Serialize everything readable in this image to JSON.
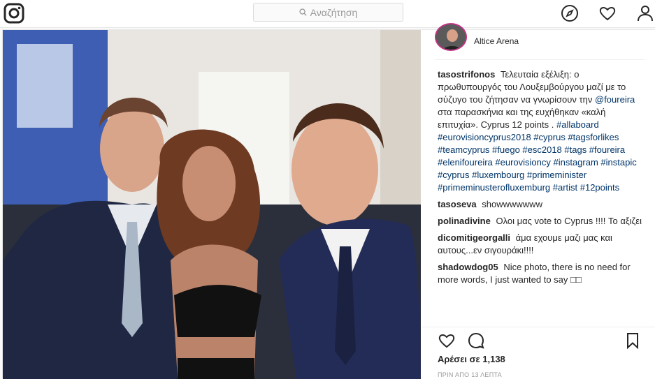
{
  "search": {
    "placeholder": "Αναζήτηση"
  },
  "post": {
    "location": "Altice Arena",
    "caption": {
      "user": "tasostrifonos",
      "text": "Τελευταία εξέλιξη: ο πρωθυπουργός του Λουξεμβούργου μαζί με το σύζυγο του ζήτησαν να γνωρίσουν την",
      "mention": "@foureira",
      "text2": "στα παρασκήνια και της ευχήθηκαν «καλή επιτυχία». Cyprus 12 points .",
      "hashtags": "#allaboard #eurovisioncyprus2018 #cyprus #tagsforlikes #teamcyprus #fuego #esc2018 #tags #foureira #elenifoureira #eurovisioncy #instagram #instapic #cyprus #luxembourg #primeminister #primeminusterofluxemburg #artist #12points"
    },
    "comments": [
      {
        "user": "tasoseva",
        "text": "showwwwwww"
      },
      {
        "user": "polinadivine",
        "text": "Ολοι μας vote to Cyprus !!!! Το αξιζει"
      },
      {
        "user": "dicomitigeorgalli",
        "text": "άμα εχουμε μαζι μας και αυτους...εν σιγουράκι!!!!"
      },
      {
        "user": "shadowdog05",
        "text": "Nice photo, there is no need for more words, I just wanted to say □□"
      }
    ],
    "likes": "Αρέσει σε 1,138",
    "timestamp": "ΠΡΙΝ ΑΠΟ 13 ΛΕΠΤΑ"
  },
  "icons": {
    "logo": "instagram-logo-icon",
    "explore": "compass-icon",
    "activity": "heart-icon",
    "profile": "person-icon",
    "like": "heart-icon",
    "comment": "comment-icon",
    "save": "bookmark-icon"
  },
  "colors": {
    "link": "#003569",
    "ring": "#c13584",
    "muted": "#999999"
  }
}
